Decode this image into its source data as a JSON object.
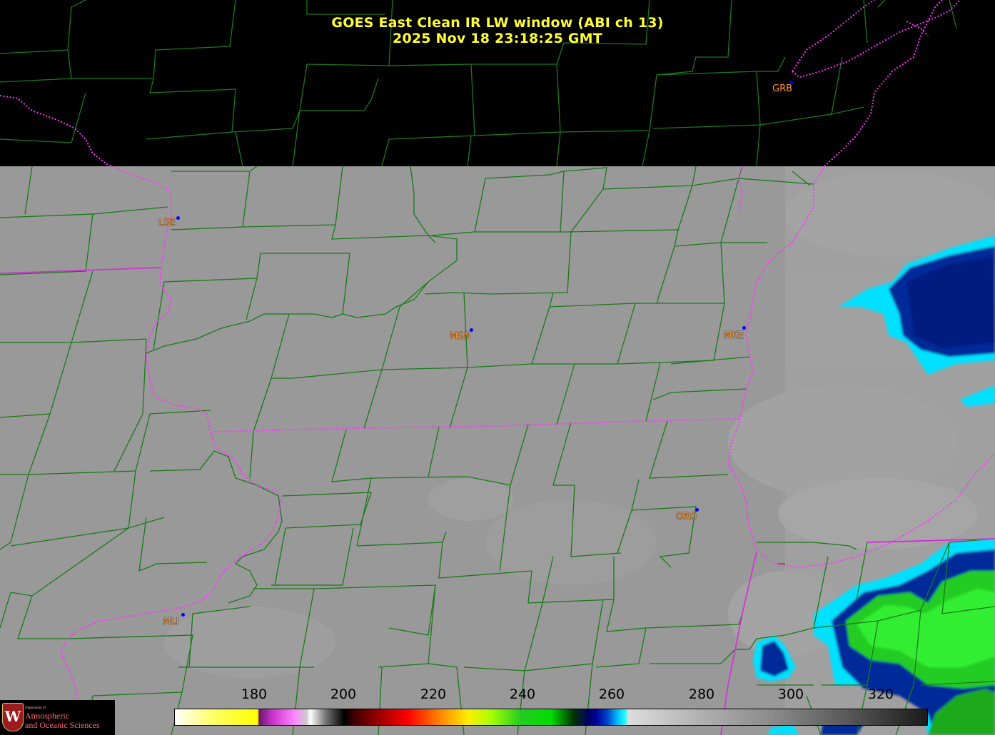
{
  "header": {
    "title": "GOES East Clean IR LW window (ABI ch 13)",
    "timestamp": "2025 Nov 18  23:18:25 GMT"
  },
  "stations": [
    {
      "code": "GRB"
    },
    {
      "code": "LSE"
    },
    {
      "code": "MSN"
    },
    {
      "code": "MKE"
    },
    {
      "code": "ORD"
    },
    {
      "code": "MLI"
    }
  ],
  "colorbar": {
    "unit_scale": [
      180,
      200,
      220,
      240,
      260,
      280,
      300,
      320
    ],
    "range": [
      163,
      331
    ]
  },
  "logo": {
    "dept": "Department of",
    "line1": "Atmospheric",
    "line2": "and Oceanic Sciences",
    "seal_letter": "W"
  },
  "colors": {
    "title": "#ffff33",
    "county_lines": "#1a7a1a",
    "state_lines": "#ff33ff",
    "station_label": "#ff9933",
    "station_dot": "#0000ff",
    "background_ir": "#9a9a9a",
    "no_data": "#000000"
  }
}
